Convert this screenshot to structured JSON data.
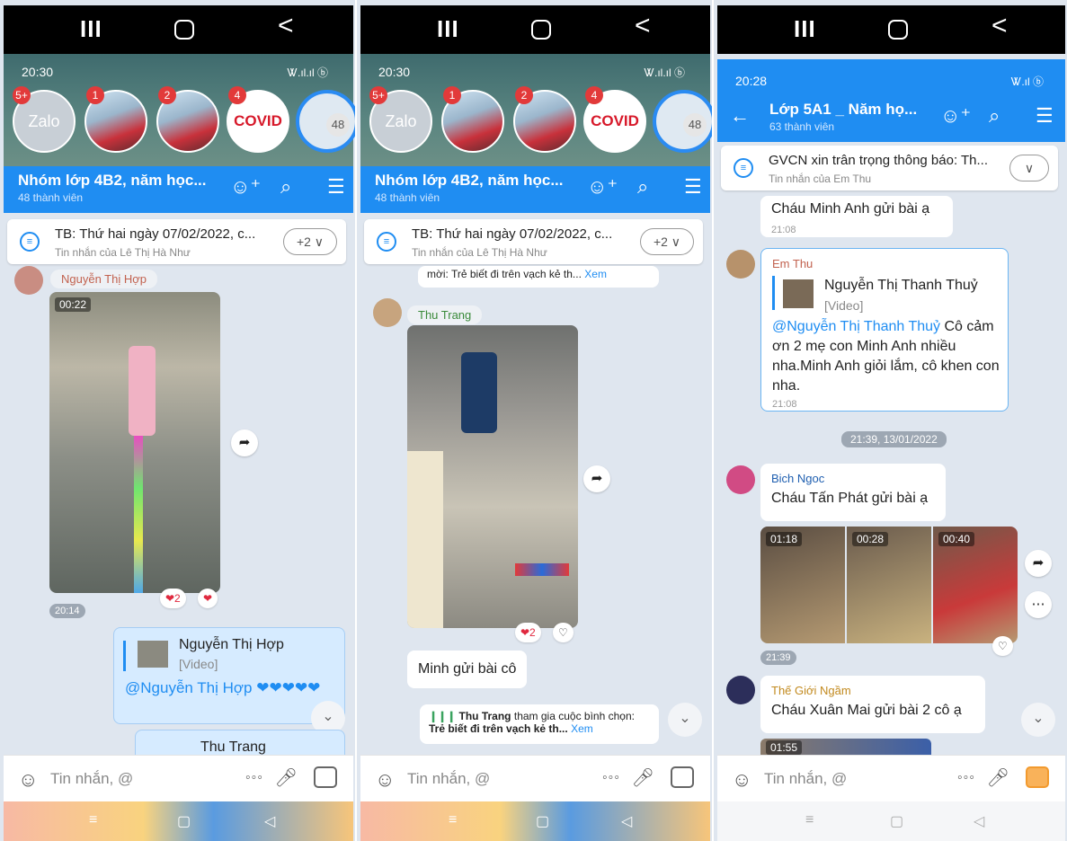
{
  "system_nav": {
    "recents": "III",
    "home": "◻",
    "back": "<"
  },
  "panel1": {
    "status_time": "20:30",
    "signal": "Ꮤ.ıl.ıl ⓑ",
    "bubbles": {
      "zalo_label": "Zalo",
      "zalo_badge": "5+",
      "b2_badge": "1",
      "b3_badge": "2",
      "covid_label": "COVID",
      "covid_badge": "4",
      "group_count": "48"
    },
    "header": {
      "title": "Nhóm lớp 4B2, năm học...",
      "subtitle": "48 thành viên"
    },
    "pin": {
      "title": "TB: Thứ hai ngày 07/02/2022, c...",
      "sub": "Tin nhắn của Lê Thị Hà Như",
      "more": "+2 ∨"
    },
    "sender_name": "Nguyễn Thị Hợp",
    "video_time": "00:22",
    "reactions": "❤2",
    "reaction_single": "❤",
    "timestamp": "20:14",
    "reply": {
      "quoted_name": "Nguyễn Thị Hợp",
      "quoted_type": "[Video]",
      "text": "@Nguyễn Thị Hợp ❤❤❤❤❤"
    },
    "reply2_name": "Thu Trang",
    "input_placeholder": "Tin nhắn, @"
  },
  "panel2": {
    "status_time": "20:30",
    "signal": "Ꮤ.ıl.ıl ⓑ",
    "bubbles": {
      "zalo_label": "Zalo",
      "zalo_badge": "5+",
      "b2_badge": "1",
      "b3_badge": "2",
      "covid_label": "COVID",
      "covid_badge": "4",
      "group_count": "48"
    },
    "header": {
      "title": "Nhóm lớp 4B2, năm học...",
      "subtitle": "48 thành viên"
    },
    "pin": {
      "title": "TB: Thứ hai ngày 07/02/2022, c...",
      "sub": "Tin nhắn của Lê Thị Hà Như",
      "more": "+2 ∨"
    },
    "partial_poll": "mời: Trẻ biết đi trên vạch kẻ th...",
    "partial_poll_link": "Xem",
    "sender_name": "Thu Trang",
    "reactions": "❤2",
    "reaction_single": "♡",
    "message": "Minh gửi bài cô",
    "poll": {
      "who": "Thu Trang",
      "action": "tham gia cuộc bình chọn:",
      "topic": "Trẻ biết đi trên vạch kẻ th...",
      "link": "Xem"
    },
    "input_placeholder": "Tin nhắn, @"
  },
  "panel3": {
    "status_time": "20:28",
    "signal": "Ꮤ.ıl ⓑ",
    "header": {
      "title": "Lớp 5A1 _ Năm họ...",
      "subtitle": "63 thành viên"
    },
    "pin": {
      "title": "GVCN xin trân trọng thông báo: Th...",
      "sub": "Tin nhắn của Em Thu",
      "more": "∨"
    },
    "msg1": {
      "text": "Cháu Minh Anh gửi bài ạ",
      "time": "21:08"
    },
    "msg2": {
      "sender": "Em Thu",
      "quoted_name": "Nguyễn Thị Thanh Thuỷ",
      "quoted_type": "[Video]",
      "mention": "@Nguyễn Thị Thanh Thuỷ",
      "text": " Cô cảm ơn 2 mẹ con Minh Anh nhiều nha.Minh Anh giỏi lắm, cô khen con nha.",
      "time": "21:08"
    },
    "date_sep": "21:39, 13/01/2022",
    "msg3": {
      "sender": "Bich Ngoc",
      "text": "Cháu Tấn Phát gửi bài ạ",
      "v1": "01:18",
      "v2": "00:28",
      "v3": "00:40",
      "time": "21:39"
    },
    "msg4": {
      "sender": "Thế Giới Ngầm",
      "text": "Cháu Xuân Mai gửi bài 2 cô ạ",
      "v1": "01:55"
    },
    "input_placeholder": "Tin nhắn, @"
  }
}
